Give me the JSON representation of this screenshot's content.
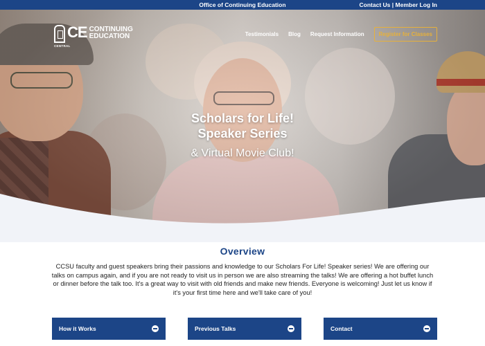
{
  "topbar": {
    "center": "Office of Continuing Education",
    "contact": "Contact Us",
    "separator": "|",
    "login": "Member Log In"
  },
  "logo": {
    "central": "CENTRAL",
    "ce": "CE",
    "line1": "CONTINUING",
    "line2": "EDUCATION"
  },
  "nav": {
    "items": [
      "Testimonials",
      "Blog",
      "Request Information"
    ],
    "register": "Register for Classes"
  },
  "hero": {
    "line1": "Scholars for Life!",
    "line2": "Speaker Series",
    "line3": "& Virtual Movie Club!"
  },
  "overview": {
    "title": "Overview",
    "body": "CCSU faculty and guest speakers bring their passions and knowledge to our Scholars For Life! Speaker series!  We are offering our talks on campus again, and if you are not ready to visit us in person we are also streaming the talks!  We are offering a hot buffet lunch or dinner before the talk too.  It's a great way to visit with old friends and make new friends.  Everyone is welcoming!  Just let us know if it's your first time here and we'll take care of you!"
  },
  "accordions": [
    {
      "label": "How it Works"
    },
    {
      "label": "Previous Talks"
    },
    {
      "label": "Contact"
    }
  ],
  "colors": {
    "brand_blue": "#1c4587",
    "accent_gold": "#e8b13a"
  }
}
